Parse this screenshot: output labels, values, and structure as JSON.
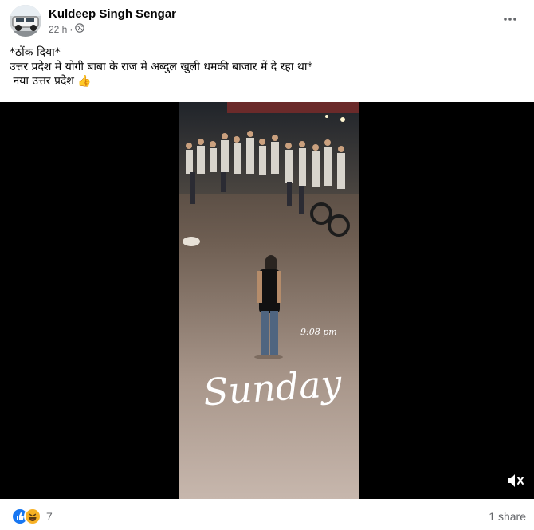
{
  "post": {
    "author": "Kuldeep Singh Sengar",
    "time": "22 h",
    "separator": "·",
    "text_lines": [
      "*ठोंक दिया*",
      "उत्तर प्रदेश मे योगी बाबा के राज मे अब्दुल खुली धमकी बाजार में दे रहा था*",
      " नया उत्तर प्रदेश 👍"
    ]
  },
  "video": {
    "overlay_time": "9:08 pm",
    "overlay_day": "Sunday"
  },
  "footer": {
    "reaction_count": "7",
    "shares": "1 share"
  },
  "colors": {
    "like_blue": "#1877f2",
    "haha_yellow": "#f7b125",
    "meta_gray": "#65676b"
  },
  "icons": [
    "more-options-icon",
    "globe-icon",
    "mute-icon",
    "like-reaction-icon",
    "haha-reaction-icon"
  ]
}
